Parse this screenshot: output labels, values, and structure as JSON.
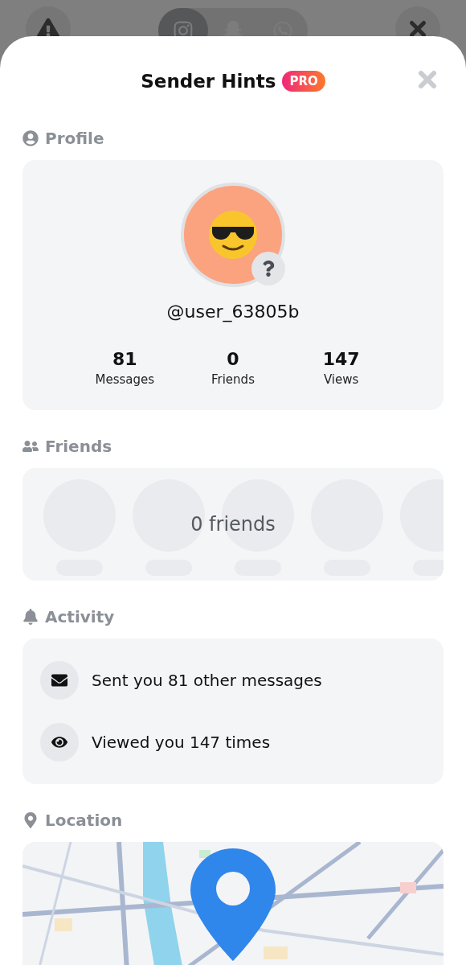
{
  "top_bar": {
    "platforms": [
      {
        "kind": "instagram",
        "selected": true
      },
      {
        "kind": "snapchat",
        "selected": false
      },
      {
        "kind": "whatsapp",
        "selected": false
      }
    ]
  },
  "sheet": {
    "title": "Sender Hints",
    "badge": "PRO"
  },
  "profile": {
    "heading": "Profile",
    "username": "@user_63805b",
    "stats": [
      {
        "value": "81",
        "label": "Messages"
      },
      {
        "value": "0",
        "label": "Friends"
      },
      {
        "value": "147",
        "label": "Views"
      }
    ]
  },
  "friends": {
    "heading": "Friends",
    "empty_text": "0 friends"
  },
  "activity": {
    "heading": "Activity",
    "items": [
      {
        "kind": "message",
        "text": "Sent you 81 other messages"
      },
      {
        "kind": "view",
        "text": "Viewed you 147 times"
      }
    ]
  },
  "location": {
    "heading": "Location"
  }
}
